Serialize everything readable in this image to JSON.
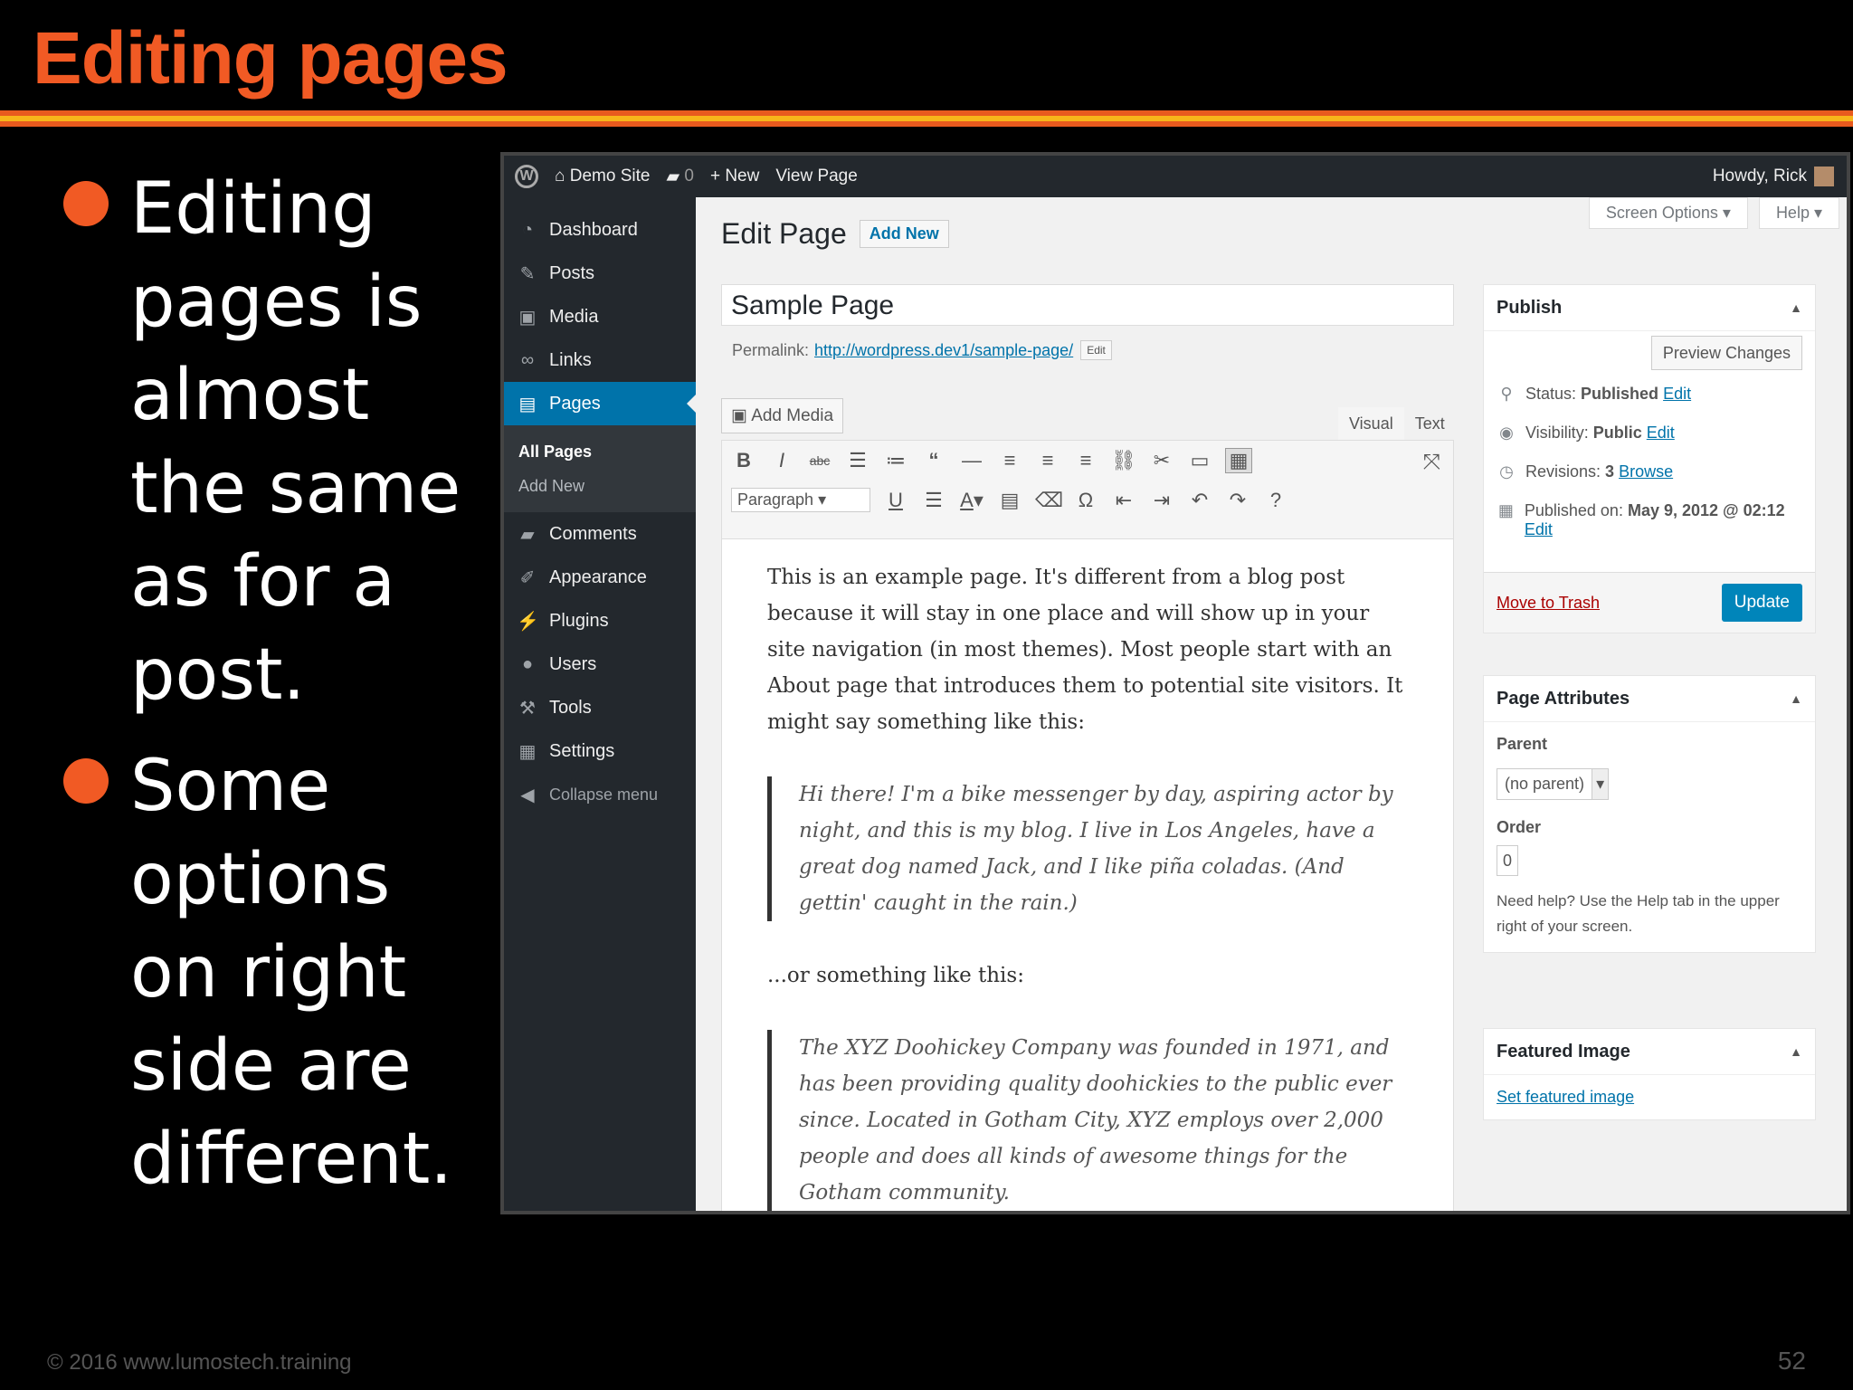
{
  "slide": {
    "title": "Editing pages",
    "rule_colors": [
      "#f15a24",
      "#f7b51a",
      "#e85a1e"
    ],
    "accent": "#f15a24",
    "bullets": [
      "Editing pages is almost the same as for a post.",
      "Some options on right side are different."
    ],
    "footer_left": "© 2016  www.lumostech.training",
    "page_number": "52"
  },
  "adminbar": {
    "site": "Demo Site",
    "comments": "0",
    "new": "New",
    "view_page": "View Page",
    "howdy": "Howdy, Rick"
  },
  "sidebar": {
    "items": [
      {
        "label": "Dashboard",
        "icon": "dashboard-icon"
      },
      {
        "label": "Posts",
        "icon": "pin-icon"
      },
      {
        "label": "Media",
        "icon": "media-icon"
      },
      {
        "label": "Links",
        "icon": "link-icon"
      },
      {
        "label": "Pages",
        "icon": "page-icon"
      },
      {
        "label": "Comments",
        "icon": "comment-icon"
      },
      {
        "label": "Appearance",
        "icon": "brush-icon"
      },
      {
        "label": "Plugins",
        "icon": "plug-icon"
      },
      {
        "label": "Users",
        "icon": "user-icon"
      },
      {
        "label": "Tools",
        "icon": "wrench-icon"
      },
      {
        "label": "Settings",
        "icon": "settings-icon"
      }
    ],
    "submenu": [
      "All Pages",
      "Add New"
    ],
    "collapse": "Collapse menu"
  },
  "header": {
    "screen_options": "Screen Options ▾",
    "help": "Help ▾",
    "title": "Edit Page",
    "add_new": "Add New"
  },
  "editor": {
    "page_title": "Sample Page",
    "permalink_label": "Permalink:",
    "permalink_url": "http://wordpress.dev1/sample-page/",
    "permalink_edit": "Edit",
    "add_media": "Add Media",
    "tab_visual": "Visual",
    "tab_text": "Text",
    "format": "Paragraph",
    "p1": "This is an example page. It's different from a blog post because it will stay in one place and will show up in your site navigation (in most themes). Most people start with an About page that introduces them to potential site visitors. It might say something like this:",
    "quote1": "Hi there! I'm a bike messenger by day, aspiring actor by night, and this is my blog. I live in Los Angeles, have a great dog named Jack, and I like piña coladas. (And gettin' caught in the rain.)",
    "p2": "...or something like this:",
    "quote2": "The XYZ Doohickey Company was founded in 1971, and has been providing quality doohickies to the public ever since. Located in Gotham City, XYZ employs over 2,000 people and does all kinds of awesome things for the Gotham community."
  },
  "publish": {
    "title": "Publish",
    "preview": "Preview Changes",
    "status_label": "Status:",
    "status_value": "Published",
    "visibility_label": "Visibility:",
    "visibility_value": "Public",
    "revisions_label": "Revisions:",
    "revisions_value": "3",
    "browse": "Browse",
    "published_label": "Published on:",
    "published_value": "May 9, 2012 @ 02:12",
    "edit": "Edit",
    "trash": "Move to Trash",
    "update": "Update"
  },
  "attributes": {
    "title": "Page Attributes",
    "parent_label": "Parent",
    "parent_value": "(no parent)",
    "order_label": "Order",
    "order_value": "0",
    "help": "Need help? Use the Help tab in the upper right of your screen."
  },
  "featured": {
    "title": "Featured Image",
    "link": "Set featured image"
  }
}
